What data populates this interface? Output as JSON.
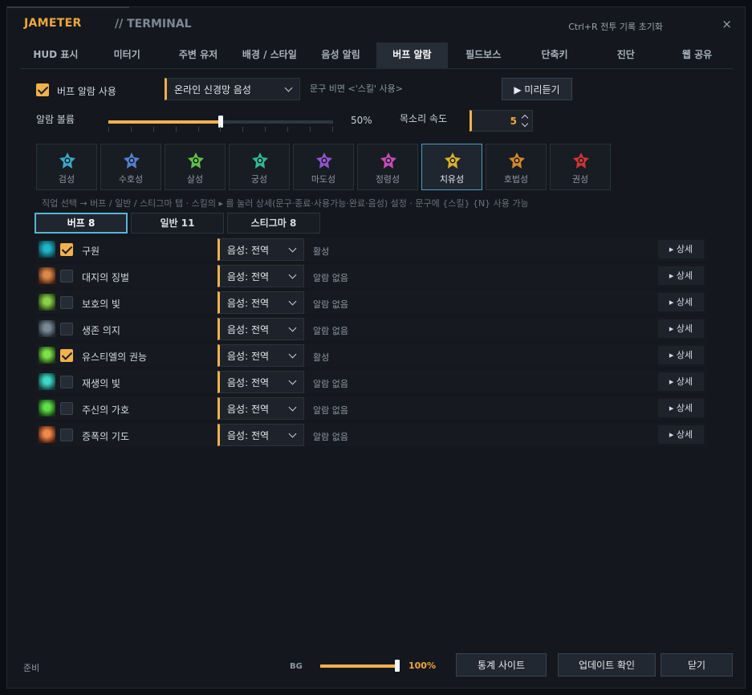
{
  "app": {
    "brand": "JAMETER",
    "subtitle": "// TERMINAL",
    "hotkey_hint": "Ctrl+R  전투 기록 초기화",
    "close": "×"
  },
  "tabs": [
    {
      "label": "HUD 표시",
      "active": false
    },
    {
      "label": "미터기",
      "active": false
    },
    {
      "label": "주변 유저",
      "active": false
    },
    {
      "label": "배경 / 스타일",
      "active": false
    },
    {
      "label": "음성 알림",
      "active": false
    },
    {
      "label": "버프 알람",
      "active": true
    },
    {
      "label": "필드보스",
      "active": false
    },
    {
      "label": "단축키",
      "active": false
    },
    {
      "label": "진단",
      "active": false
    },
    {
      "label": "웹 공유",
      "active": false
    }
  ],
  "buff_alarm": {
    "enable_label": "버프 알람 사용",
    "enabled": true,
    "voice_select": "온라인 신경망 음성",
    "hint": "문구 비면 <'스킬' 사용>",
    "preview_button": "▶ 미리듣기",
    "volume_label": "알람 볼륨",
    "volume_value": "50%",
    "volume": 0.5,
    "speed_label": "목소리 속도",
    "speed_value": "5"
  },
  "classes": [
    {
      "label": "검성",
      "icon": "sword-class-icon",
      "color": "#3fb8d8",
      "active": false
    },
    {
      "label": "수호성",
      "icon": "shield-class-icon",
      "color": "#5a8de6",
      "active": false
    },
    {
      "label": "살성",
      "icon": "assassin-class-icon",
      "color": "#6bd04a",
      "active": false
    },
    {
      "label": "궁성",
      "icon": "bow-class-icon",
      "color": "#35c9a0",
      "active": false
    },
    {
      "label": "마도성",
      "icon": "sorcerer-class-icon",
      "color": "#a05adf",
      "active": false
    },
    {
      "label": "정령성",
      "icon": "spirit-class-icon",
      "color": "#d655c8",
      "active": false
    },
    {
      "label": "치유성",
      "icon": "healer-class-icon",
      "color": "#f0c02e",
      "active": true
    },
    {
      "label": "호법성",
      "icon": "chanter-class-icon",
      "color": "#e8952e",
      "active": false
    },
    {
      "label": "권성",
      "icon": "fist-class-icon",
      "color": "#e0383a",
      "active": false
    }
  ],
  "instructions": "직업 선택 → 버프 / 일반 / 스티그마 탭 · 스킬의 ▸ 를 눌러 상세(문구·종료·사용가능·완료·음성) 설정 · 문구에 {스킬} {N} 사용 가능",
  "subtabs": [
    {
      "label": "버프  8",
      "active": true
    },
    {
      "label": "일반  11",
      "active": false
    },
    {
      "label": "스티그마  8",
      "active": false
    }
  ],
  "buffs": [
    {
      "name": "구원",
      "checked": true,
      "voice": "음성: 전역",
      "state": "활성",
      "detail": "▸ 상세",
      "icon": "salvation-skill-icon",
      "c1": "#1fb6c9",
      "c2": "#0b3a44"
    },
    {
      "name": "대지의 징벌",
      "checked": false,
      "voice": "음성: 전역",
      "state": "알람 없음",
      "detail": "▸ 상세",
      "icon": "earth-punishment-skill-icon",
      "c1": "#d98a4a",
      "c2": "#4a1f10"
    },
    {
      "name": "보호의 빛",
      "checked": false,
      "voice": "음성: 전역",
      "state": "알람 없음",
      "detail": "▸ 상세",
      "icon": "protection-light-skill-icon",
      "c1": "#8fd04a",
      "c2": "#1f3a10"
    },
    {
      "name": "생존 의지",
      "checked": false,
      "voice": "음성: 전역",
      "state": "알람 없음",
      "detail": "▸ 상세",
      "icon": "survival-will-skill-icon",
      "c1": "#7a8a96",
      "c2": "#1e2830"
    },
    {
      "name": "유스티엘의 권능",
      "checked": true,
      "voice": "음성: 전역",
      "state": "활성",
      "detail": "▸ 상세",
      "icon": "yustiel-power-skill-icon",
      "c1": "#7ee04a",
      "c2": "#1a3a12"
    },
    {
      "name": "재생의 빛",
      "checked": false,
      "voice": "음성: 전역",
      "state": "알람 없음",
      "detail": "▸ 상세",
      "icon": "regeneration-light-skill-icon",
      "c1": "#3ed8c8",
      "c2": "#0e3a36"
    },
    {
      "name": "주신의 가호",
      "checked": false,
      "voice": "음성: 전역",
      "state": "알람 없음",
      "detail": "▸ 상세",
      "icon": "divine-blessing-skill-icon",
      "c1": "#5ee04a",
      "c2": "#123a10"
    },
    {
      "name": "증폭의 기도",
      "checked": false,
      "voice": "음성: 전역",
      "state": "알람 없음",
      "detail": "▸ 상세",
      "icon": "amplify-prayer-skill-icon",
      "c1": "#f08a4a",
      "c2": "#4a1a0e"
    }
  ],
  "footer": {
    "status": "준비",
    "bg_label": "BG",
    "bg_value": "100%",
    "bg": 1.0,
    "stats_button": "통계 사이트",
    "update_button": "업데이트 확인",
    "close_button": "닫기"
  }
}
